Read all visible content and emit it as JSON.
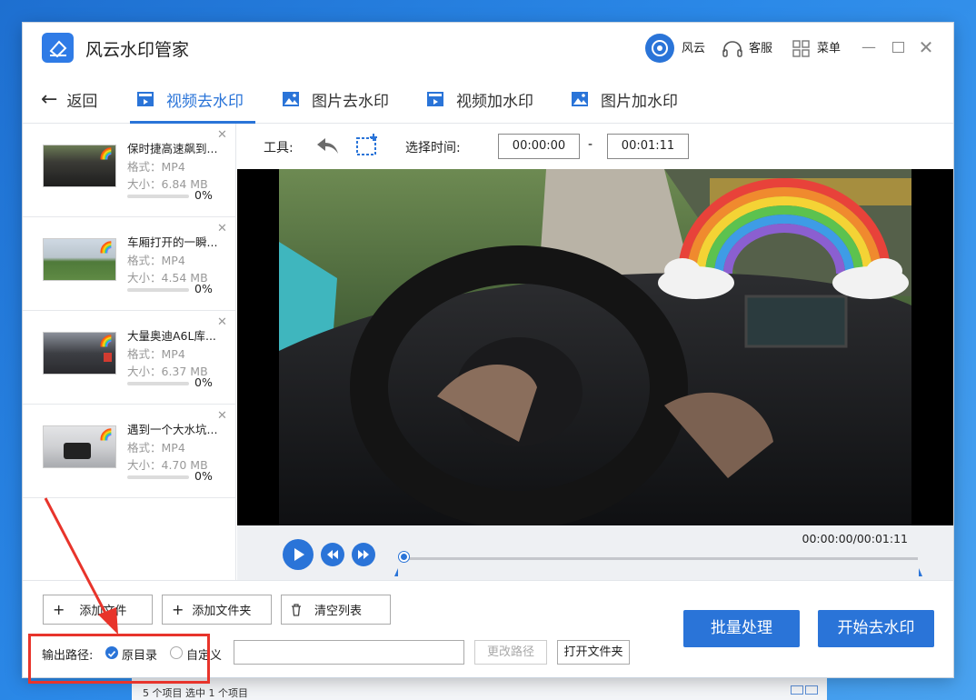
{
  "desktop_strip": {
    "text": "5 个项目    选中 1 个项目"
  },
  "app": {
    "title": "风云水印管家",
    "brand_label": "风云",
    "service_label": "客服",
    "menu_label": "菜单",
    "accent": "#2a74d8",
    "annotation_color": "#e8342b"
  },
  "nav": {
    "back_label": "返回",
    "tabs": [
      {
        "label": "视频去水印",
        "icon": "video-icon",
        "active": true
      },
      {
        "label": "图片去水印",
        "icon": "image-icon",
        "active": false
      },
      {
        "label": "视频加水印",
        "icon": "video-icon",
        "active": false
      },
      {
        "label": "图片加水印",
        "icon": "image-icon",
        "active": false
      }
    ]
  },
  "files": [
    {
      "name": "保时捷高速飙到...",
      "format": "格式：MP4",
      "size": "大小：6.84 MB",
      "progress": "0%",
      "progress_value": 0
    },
    {
      "name": "车厢打开的一瞬...",
      "format": "格式：MP4",
      "size": "大小：4.54 MB",
      "progress": "0%",
      "progress_value": 0
    },
    {
      "name": "大量奥迪A6L库...",
      "format": "格式：MP4",
      "size": "大小：6.37 MB",
      "progress": "0%",
      "progress_value": 0
    },
    {
      "name": "遇到一个大水坑...",
      "format": "格式：MP4",
      "size": "大小：4.70 MB",
      "progress": "0%",
      "progress_value": 0
    }
  ],
  "toolbar": {
    "tools_label": "工具:",
    "time_label": "选择时间:",
    "start_time": "00:00:00",
    "separator": "-",
    "end_time": "00:01:11"
  },
  "player": {
    "timecode": "00:00:00/00:01:11",
    "progress": 0
  },
  "bottom": {
    "add_file_label": "添加文件",
    "add_folder_label": "添加文件夹",
    "clear_list_label": "清空列表",
    "output_label": "输出路径:",
    "option_original": "原目录",
    "option_custom": "自定义",
    "selected_option": "原目录",
    "path_value": "",
    "change_path_label": "更改路径",
    "open_folder_label": "打开文件夹",
    "batch_label": "批量处理",
    "start_label": "开始去水印"
  }
}
